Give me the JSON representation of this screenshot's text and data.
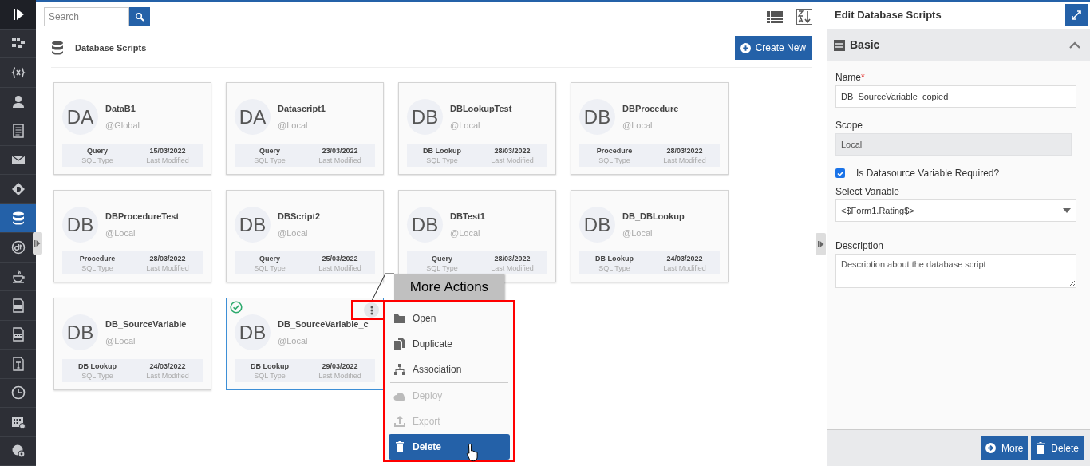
{
  "sidebar": {
    "items": [
      {
        "selected": false
      },
      {
        "selected": false
      },
      {
        "selected": false
      },
      {
        "selected": false
      },
      {
        "selected": false
      },
      {
        "selected": false
      },
      {
        "selected": false
      },
      {
        "selected": true
      },
      {
        "selected": false
      },
      {
        "selected": false
      },
      {
        "selected": false
      },
      {
        "selected": false
      },
      {
        "selected": false
      },
      {
        "selected": false
      },
      {
        "selected": false
      },
      {
        "selected": false
      }
    ]
  },
  "search": {
    "placeholder": "Search"
  },
  "header": {
    "title": "Database Scripts",
    "create_button": "Create New"
  },
  "cards": [
    {
      "initials": "DA",
      "title": "DataB1",
      "scope": "@Global",
      "sql_type": "Query",
      "sql_type_label": "SQL Type",
      "date": "15/03/2022",
      "date_label": "Last Modified",
      "selected": false
    },
    {
      "initials": "DA",
      "title": "Datascript1",
      "scope": "@Local",
      "sql_type": "Query",
      "sql_type_label": "SQL Type",
      "date": "23/03/2022",
      "date_label": "Last Modified",
      "selected": false
    },
    {
      "initials": "DB",
      "title": "DBLookupTest",
      "scope": "@Local",
      "sql_type": "DB Lookup",
      "sql_type_label": "SQL Type",
      "date": "28/03/2022",
      "date_label": "Last Modified",
      "selected": false
    },
    {
      "initials": "DB",
      "title": "DBProcedure",
      "scope": "@Local",
      "sql_type": "Procedure",
      "sql_type_label": "SQL Type",
      "date": "28/03/2022",
      "date_label": "Last Modified",
      "selected": false
    },
    {
      "initials": "DB",
      "title": "DBProcedureTest",
      "scope": "@Local",
      "sql_type": "Procedure",
      "sql_type_label": "SQL Type",
      "date": "28/03/2022",
      "date_label": "Last Modified",
      "selected": false
    },
    {
      "initials": "DB",
      "title": "DBScript2",
      "scope": "@Local",
      "sql_type": "Query",
      "sql_type_label": "SQL Type",
      "date": "25/03/2022",
      "date_label": "Last Modified",
      "selected": false
    },
    {
      "initials": "DB",
      "title": "DBTest1",
      "scope": "@Local",
      "sql_type": "Query",
      "sql_type_label": "SQL Type",
      "date": "28/03/2022",
      "date_label": "Last Modified",
      "selected": false
    },
    {
      "initials": "DB",
      "title": "DB_DBLookup",
      "scope": "@Local",
      "sql_type": "DB Lookup",
      "sql_type_label": "SQL Type",
      "date": "24/03/2022",
      "date_label": "Last Modified",
      "selected": false
    },
    {
      "initials": "DB",
      "title": "DB_SourceVariable",
      "scope": "@Local",
      "sql_type": "DB Lookup",
      "sql_type_label": "SQL Type",
      "date": "24/03/2022",
      "date_label": "Last Modified",
      "selected": false
    },
    {
      "initials": "DB",
      "title": "DB_SourceVariable_c",
      "scope": "@Local",
      "sql_type": "DB Lookup",
      "sql_type_label": "SQL Type",
      "date": "29/03/2022",
      "date_label": "Last Modified",
      "selected": true
    }
  ],
  "callout": {
    "text": "More Actions"
  },
  "menu": {
    "items": [
      {
        "label": "Open",
        "disabled": false,
        "selected": false,
        "divider_before": false
      },
      {
        "label": "Duplicate",
        "disabled": false,
        "selected": false,
        "divider_before": false
      },
      {
        "label": "Association",
        "disabled": false,
        "selected": false,
        "divider_before": false
      },
      {
        "label": "Deploy",
        "disabled": true,
        "selected": false,
        "divider_before": true
      },
      {
        "label": "Export",
        "disabled": true,
        "selected": false,
        "divider_before": false
      },
      {
        "label": "Delete",
        "disabled": false,
        "selected": true,
        "divider_before": false
      }
    ]
  },
  "panel": {
    "title": "Edit Database Scripts",
    "section": {
      "title": "Basic",
      "expanded": true
    },
    "name": {
      "label": "Name",
      "required_mark": "*",
      "value": "DB_SourceVariable_copied"
    },
    "scope": {
      "label": "Scope",
      "value": "Local",
      "disabled": true
    },
    "checkbox": {
      "label": "Is Datasource Variable Required?",
      "checked": true
    },
    "select": {
      "label": "Select Variable",
      "value": "<$Form1.Rating$>"
    },
    "description": {
      "label": "Description",
      "value": "Description about the database script"
    },
    "buttons": [
      "More",
      "Delete"
    ]
  }
}
